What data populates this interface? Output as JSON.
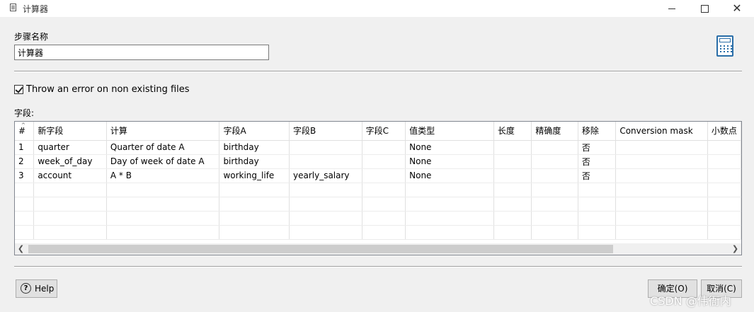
{
  "window": {
    "title": "计算器"
  },
  "step": {
    "label": "步骤名称",
    "value": "计算器"
  },
  "options": {
    "throw_error_label": "Throw an error on non existing files",
    "throw_error_checked": true
  },
  "fields": {
    "label": "字段:",
    "columns": [
      "#",
      "新字段",
      "计算",
      "字段A",
      "字段B",
      "字段C",
      "值类型",
      "长度",
      "精确度",
      "移除",
      "Conversion mask",
      "小数点"
    ],
    "rows": [
      [
        "1",
        "quarter",
        "Quarter of date A",
        "birthday",
        "",
        "",
        "None",
        "",
        "",
        "否",
        "",
        ""
      ],
      [
        "2",
        "week_of_day",
        "Day of week of date A",
        "birthday",
        "",
        "",
        "None",
        "",
        "",
        "否",
        "",
        ""
      ],
      [
        "3",
        "account",
        "A * B",
        "working_life",
        "yearly_salary",
        "",
        "None",
        "",
        "",
        "否",
        "",
        ""
      ]
    ],
    "empty_rows": 4
  },
  "buttons": {
    "help": "Help",
    "ok": "确定(O)",
    "cancel": "取消(C)"
  },
  "watermark": "CSDN @伟衙内"
}
